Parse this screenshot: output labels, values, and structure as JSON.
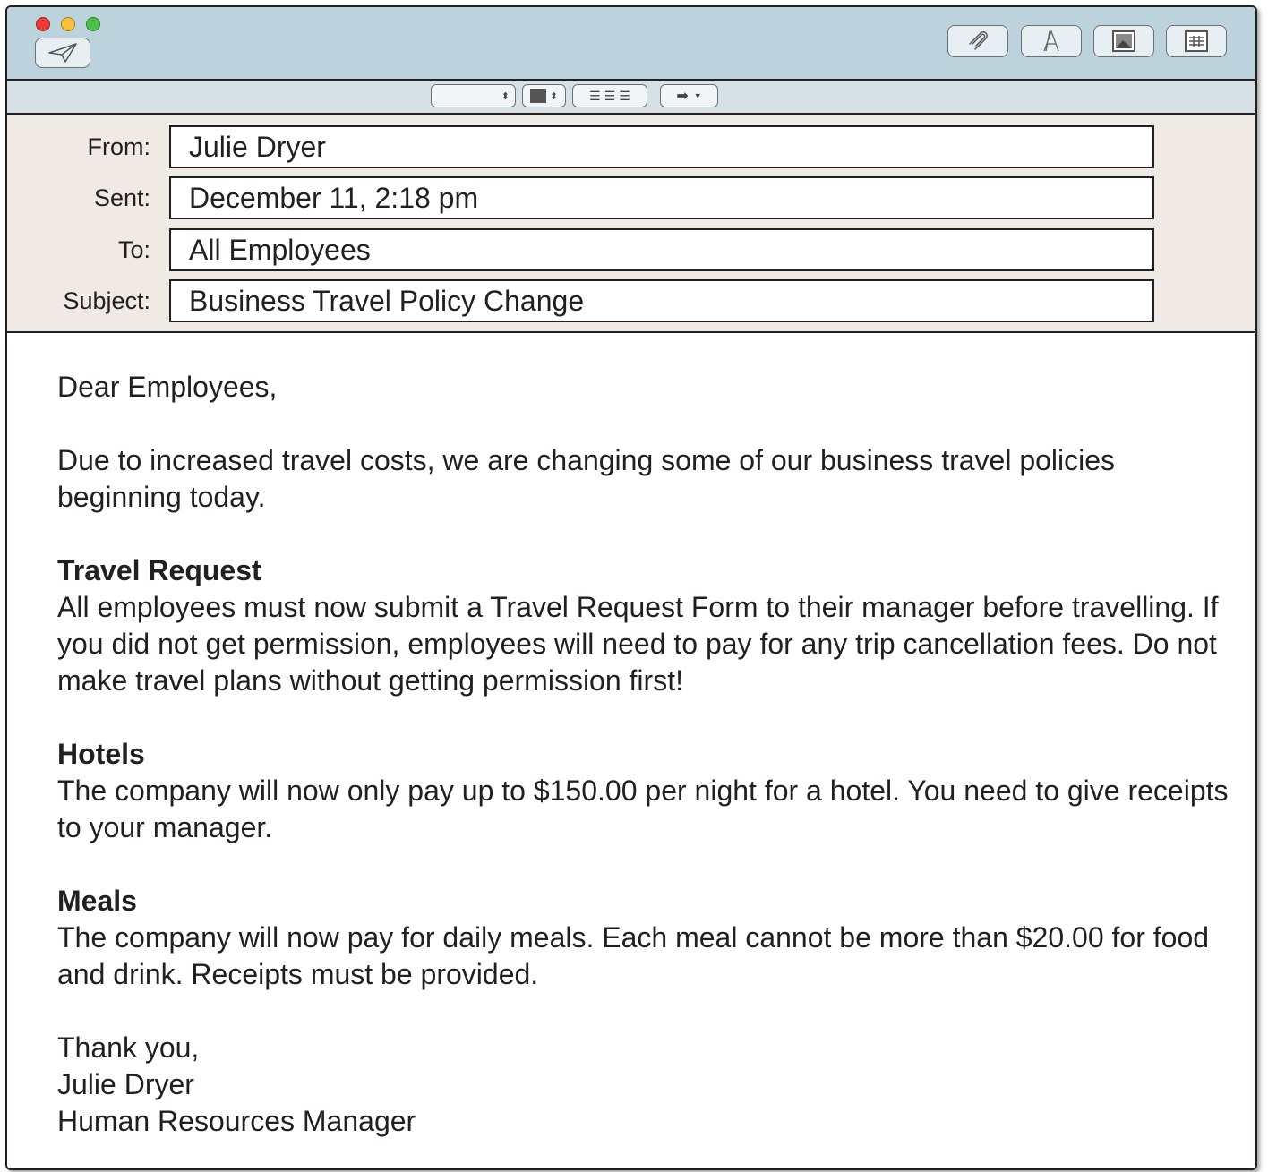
{
  "window": {
    "toolbar": {
      "send_icon": "paper-plane-icon",
      "attach_icon": "paperclip-icon",
      "font_icon": "letter-a-icon",
      "photo_icon": "photo-icon",
      "table_icon": "table-icon"
    },
    "format_bar": {
      "font_select_value": "",
      "indent_icon": "arrow-right-icon"
    }
  },
  "header": {
    "from_label": "From:",
    "from_value": "Julie Dryer",
    "sent_label": "Sent:",
    "sent_value": "December 11, 2:18 pm",
    "to_label": "To:",
    "to_value": "All Employees",
    "subject_label": "Subject:",
    "subject_value": "Business Travel Policy Change"
  },
  "body": {
    "greeting": "Dear Employees,",
    "intro": "Due to increased travel costs, we are changing some of our business travel policies beginning today.",
    "sections": [
      {
        "title": "Travel Request",
        "text": "All employees must now submit a Travel Request Form to their manager before travelling. If you did not get permission, employees will need to pay for any trip cancellation fees. Do not make travel plans without getting permission first!"
      },
      {
        "title": "Hotels",
        "text": "The company will now only pay up to $150.00 per night for a hotel. You need to give receipts to your manager."
      },
      {
        "title": "Meals",
        "text": "The company will now pay for daily meals. Each meal cannot be more than $20.00 for food and drink. Receipts must be provided."
      }
    ],
    "closing": "Thank you,",
    "signature_name": "Julie Dryer",
    "signature_title": "Human Resources Manager"
  },
  "colors": {
    "toolbar_bg": "#bcd3dd",
    "format_bar_bg": "#d6e1e6",
    "header_bg": "#efebe4",
    "traffic_red": "#ec3a34",
    "traffic_yellow": "#f6c23a",
    "traffic_green": "#4dbf4a"
  }
}
